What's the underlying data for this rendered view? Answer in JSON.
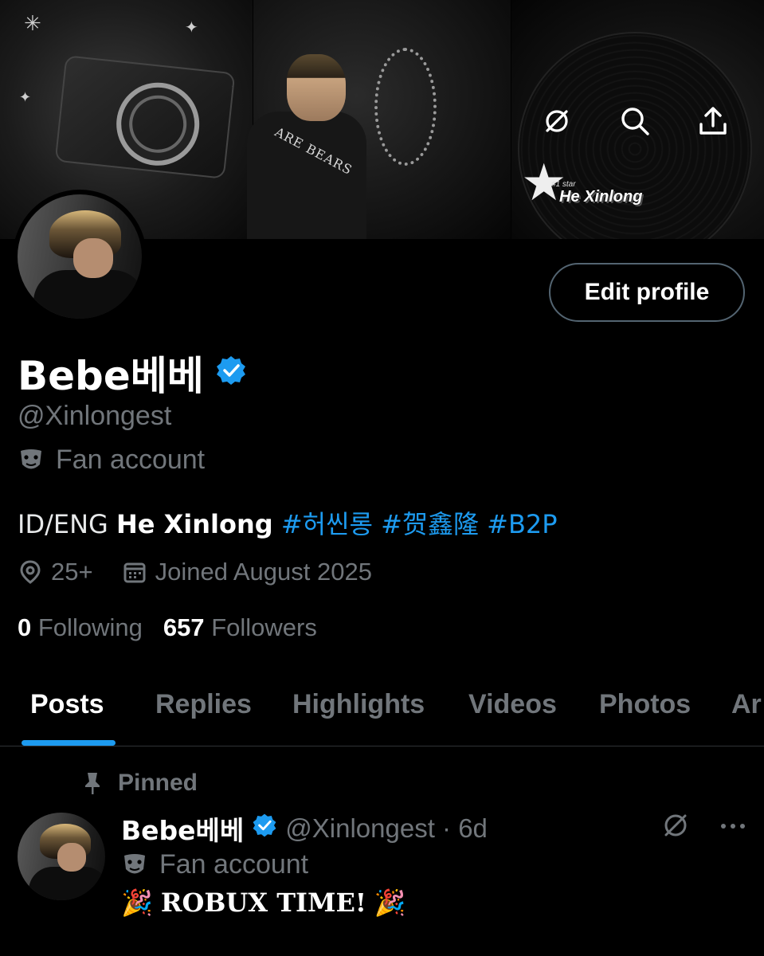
{
  "banner": {
    "shirt_text": "ARE BEARS",
    "sticker_small": "#1 star",
    "sticker_name": "He Xinlong"
  },
  "actions": {
    "edit_profile": "Edit profile"
  },
  "profile": {
    "display_name": "Bebe베베",
    "handle": "@Xinlongest",
    "category": "Fan account",
    "bio": {
      "prefix": "ID/ENG ",
      "bold": "He Xinlong",
      "tags": " #허씬롱 #贺鑫隆 #B2P"
    },
    "location": "25+",
    "joined": "Joined August 2025",
    "following_count": "0",
    "following_label": "Following",
    "followers_count": "657",
    "followers_label": "Followers"
  },
  "tabs": [
    "Posts",
    "Replies",
    "Highlights",
    "Videos",
    "Photos",
    "Ar"
  ],
  "pinned_post": {
    "pinned_label": "Pinned",
    "author": "Bebe베베",
    "handle_time": "@Xinlongest · 6d",
    "category": "Fan account",
    "text": "ROBUX TIME!",
    "emoji": "🎉"
  },
  "colors": {
    "accent": "#1d9bf0",
    "muted": "#71767b",
    "background": "#000000"
  }
}
